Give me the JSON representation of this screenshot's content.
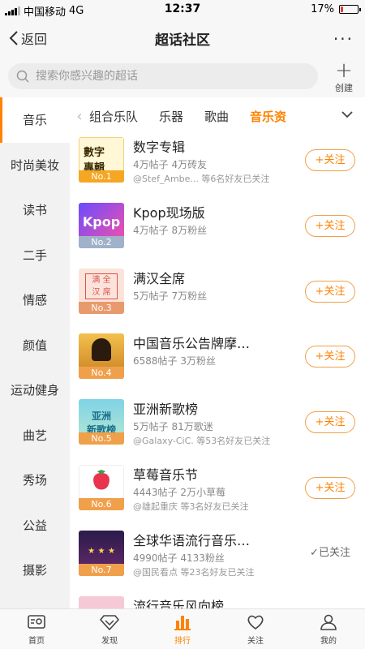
{
  "status_bar": {
    "carrier": "中国移动",
    "network": "4G",
    "time": "12:37",
    "battery": "17%",
    "battery_level": 0.17
  },
  "nav": {
    "back_label": "返回",
    "title": "超话社区",
    "more_label": "···"
  },
  "search": {
    "placeholder": "搜索你感兴趣的超话",
    "create_label": "创建"
  },
  "sidebar": {
    "items": [
      {
        "label": "音乐",
        "active": true
      },
      {
        "label": "时尚美妆"
      },
      {
        "label": "读书"
      },
      {
        "label": "二手"
      },
      {
        "label": "情感"
      },
      {
        "label": "颜值"
      },
      {
        "label": "运动健身"
      },
      {
        "label": "曲艺"
      },
      {
        "label": "秀场"
      },
      {
        "label": "公益"
      },
      {
        "label": "摄影"
      }
    ]
  },
  "subtabs": {
    "items": [
      "组合乐队",
      "乐器",
      "歌曲",
      "音乐资"
    ],
    "active_index": 3
  },
  "list": {
    "items": [
      {
        "title": "数字专辑",
        "stats": "4万帖子  4万砖友",
        "friends": "@Stef_Ambe...  等6名好友已关注",
        "rank": "No.1",
        "badge": "gold",
        "action": "+关注",
        "followed": false
      },
      {
        "title": "Kpop现场版",
        "stats": "4万帖子  8万粉丝",
        "friends": "",
        "rank": "No.2",
        "badge": "silver",
        "action": "+关注",
        "followed": false
      },
      {
        "title": "满汉全席",
        "stats": "5万帖子  7万粉丝",
        "friends": "",
        "rank": "No.3",
        "badge": "bronze",
        "action": "+关注",
        "followed": false
      },
      {
        "title": "中国音乐公告牌摩…",
        "stats": "6588帖子  3万粉丝",
        "friends": "",
        "rank": "No.4",
        "badge": "plain",
        "action": "+关注",
        "followed": false
      },
      {
        "title": "亚洲新歌榜",
        "stats": "5万帖子  81万歌迷",
        "friends": "@Galaxy-CiC.  等53名好友已关注",
        "rank": "No.5",
        "badge": "plain",
        "action": "+关注",
        "followed": false
      },
      {
        "title": "草莓音乐节",
        "stats": "4443帖子  2万小草莓",
        "friends": "@雄起重庆  等3名好友已关注",
        "rank": "No.6",
        "badge": "plain",
        "action": "+关注",
        "followed": false
      },
      {
        "title": "全球华语流行音乐…",
        "stats": "4990帖子  4133粉丝",
        "friends": "@国民看点  等23名好友已关注",
        "rank": "No.7",
        "badge": "plain",
        "action": "已关注",
        "followed": true
      },
      {
        "title": "流行音乐风向榜",
        "stats": "",
        "friends": "",
        "rank": "",
        "badge": "plain",
        "action": "",
        "followed": false
      }
    ]
  },
  "tabbar": {
    "items": [
      {
        "label": "首页",
        "icon": "home-icon"
      },
      {
        "label": "发现",
        "icon": "discover-icon"
      },
      {
        "label": "排行",
        "icon": "ranking-icon",
        "active": true
      },
      {
        "label": "关注",
        "icon": "heart-icon"
      },
      {
        "label": "我的",
        "icon": "profile-icon"
      }
    ]
  },
  "colors": {
    "accent": "#ff8200",
    "sidebar_bg": "#f2f2f2",
    "header_bg": "#f7f7f7"
  }
}
